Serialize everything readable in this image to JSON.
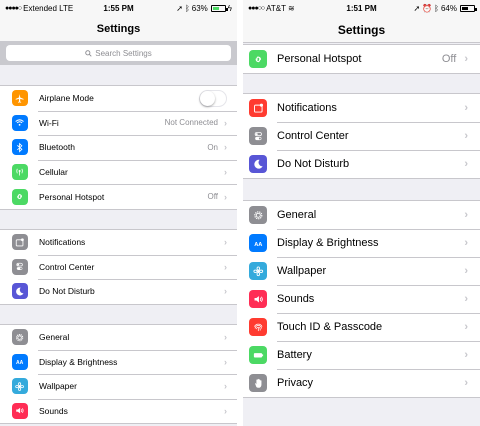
{
  "left": {
    "status": {
      "carrier": "Extended  LTE",
      "time": "1:55 PM",
      "battery": "63%",
      "battery_level": 0.63
    },
    "title": "Settings",
    "search": {
      "placeholder": "Search Settings"
    },
    "groups": [
      [
        {
          "label": "Airplane Mode",
          "icon": "airplane-icon",
          "color": "#ff9500",
          "toggle": false
        },
        {
          "label": "Wi-Fi",
          "icon": "wifi-icon",
          "color": "#007aff",
          "value": "Not Connected"
        },
        {
          "label": "Bluetooth",
          "icon": "bluetooth-icon",
          "color": "#007aff",
          "value": "On"
        },
        {
          "label": "Cellular",
          "icon": "cellular-icon",
          "color": "#4cd964",
          "value": ""
        },
        {
          "label": "Personal Hotspot",
          "icon": "hotspot-icon",
          "color": "#4cd964",
          "value": "Off"
        }
      ],
      [
        {
          "label": "Notifications",
          "icon": "notifications-icon",
          "color": "#8e8e93",
          "value": ""
        },
        {
          "label": "Control Center",
          "icon": "control-center-icon",
          "color": "#8e8e93",
          "value": ""
        },
        {
          "label": "Do Not Disturb",
          "icon": "moon-icon",
          "color": "#5856d6",
          "value": ""
        }
      ],
      [
        {
          "label": "General",
          "icon": "gear-icon",
          "color": "#8e8e93",
          "value": ""
        },
        {
          "label": "Display & Brightness",
          "icon": "display-icon",
          "color": "#007aff",
          "value": ""
        },
        {
          "label": "Wallpaper",
          "icon": "wallpaper-icon",
          "color": "#34aadc",
          "value": ""
        },
        {
          "label": "Sounds",
          "icon": "sounds-icon",
          "color": "#ff2d55",
          "value": ""
        }
      ]
    ]
  },
  "right": {
    "status": {
      "carrier": "AT&T",
      "time": "1:51 PM",
      "battery": "64%",
      "battery_level": 0.64
    },
    "title": "Settings",
    "groups": [
      [
        {
          "label": "Personal Hotspot",
          "icon": "hotspot-icon",
          "color": "#4cd964",
          "value": "Off"
        }
      ],
      [
        {
          "label": "Notifications",
          "icon": "notifications-icon",
          "color": "#ff3b30",
          "value": ""
        },
        {
          "label": "Control Center",
          "icon": "control-center-icon",
          "color": "#8e8e93",
          "value": ""
        },
        {
          "label": "Do Not Disturb",
          "icon": "moon-icon",
          "color": "#5856d6",
          "value": ""
        }
      ],
      [
        {
          "label": "General",
          "icon": "gear-icon",
          "color": "#8e8e93",
          "value": ""
        },
        {
          "label": "Display & Brightness",
          "icon": "display-icon",
          "color": "#007aff",
          "value": ""
        },
        {
          "label": "Wallpaper",
          "icon": "wallpaper-icon",
          "color": "#34aadc",
          "value": ""
        },
        {
          "label": "Sounds",
          "icon": "sounds-icon",
          "color": "#ff2d55",
          "value": ""
        },
        {
          "label": "Touch ID & Passcode",
          "icon": "fingerprint-icon",
          "color": "#ff3b30",
          "value": ""
        },
        {
          "label": "Battery",
          "icon": "battery-icon",
          "color": "#4cd964",
          "value": ""
        },
        {
          "label": "Privacy",
          "icon": "hand-icon",
          "color": "#8e8e93",
          "value": ""
        }
      ]
    ]
  },
  "chevron": "›"
}
